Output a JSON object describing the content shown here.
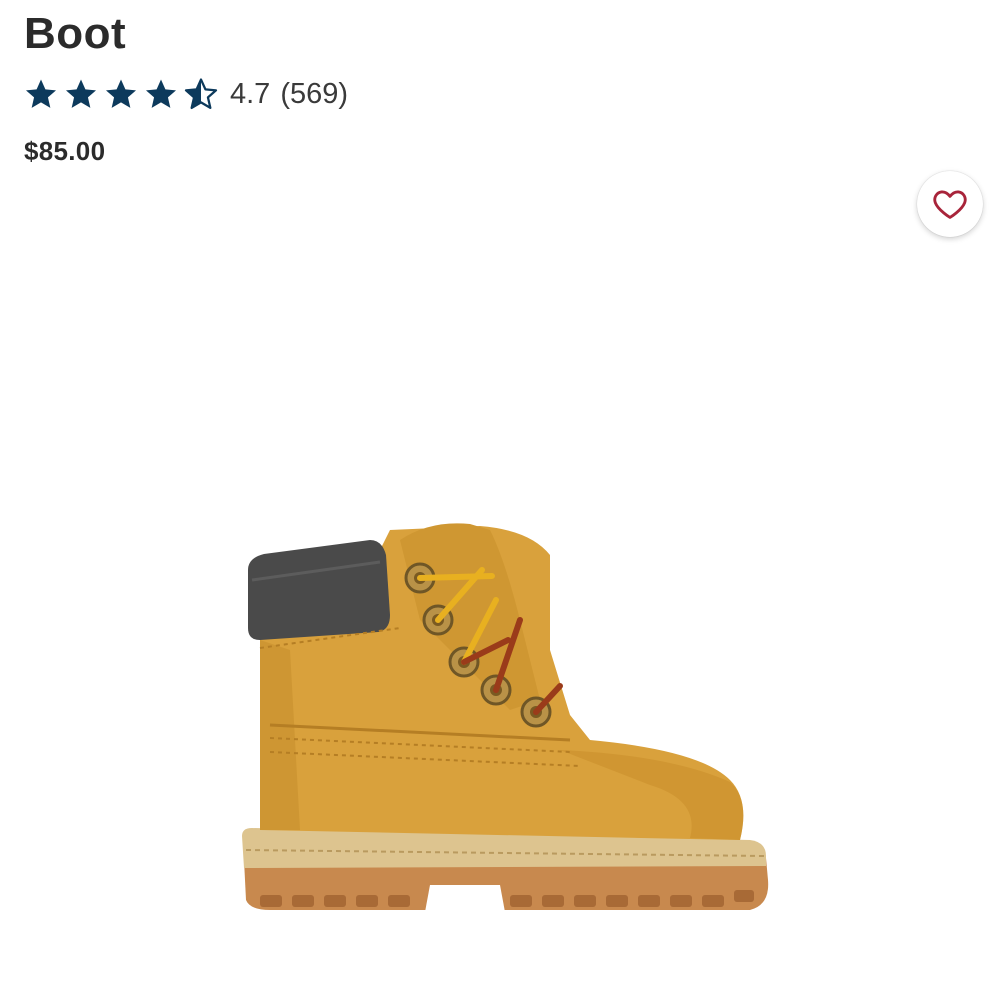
{
  "product": {
    "title": "Boot",
    "rating_value": "4.7",
    "review_count": "(569)",
    "rating": 4.7,
    "rating_max": 5,
    "price": "$85.00"
  },
  "icons": {
    "star": "star-icon",
    "wishlist": "heart-icon"
  },
  "colors": {
    "star": "#0d3a5c",
    "heart": "#a8243a",
    "text": "#2b2b2b"
  }
}
